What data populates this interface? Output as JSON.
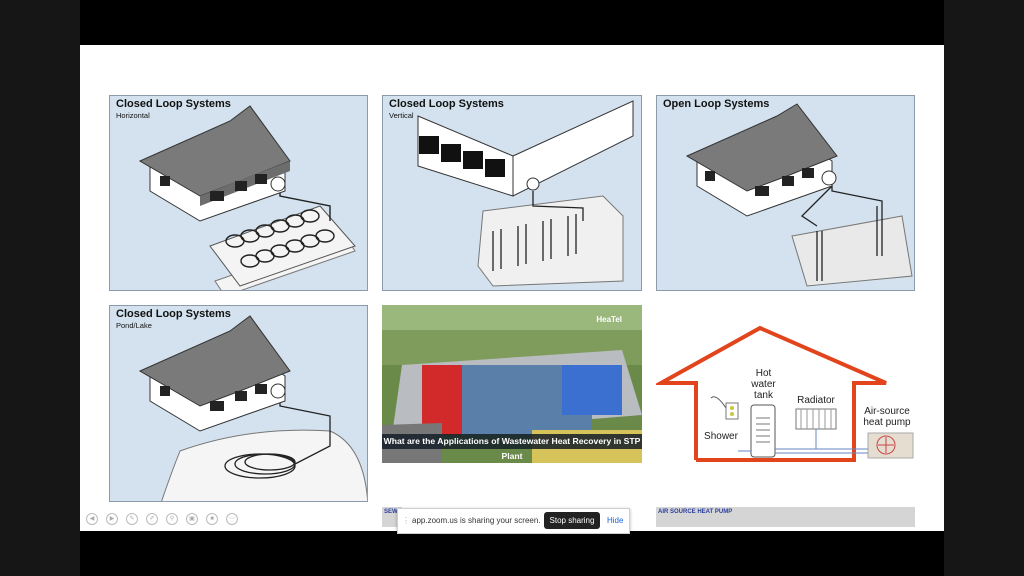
{
  "panels": {
    "closed_horizontal": {
      "title": "Closed Loop Systems",
      "subtitle": "Horizontal"
    },
    "closed_vertical": {
      "title": "Closed Loop Systems",
      "subtitle": "Vertical"
    },
    "open_loop": {
      "title": "Open Loop Systems"
    },
    "closed_pond": {
      "title": "Closed Loop Systems",
      "subtitle": "Pond/Lake"
    }
  },
  "photo": {
    "caption": "What are the Applications of Wastewater Heat Recovery in STP Plant",
    "logo": "HeaTel"
  },
  "ashp_diagram": {
    "hot_water_tank_line1": "Hot",
    "hot_water_tank_line2": "water",
    "hot_water_tank_line3": "tank",
    "radiator": "Radiator",
    "shower": "Shower",
    "air_source_line1": "Air-source",
    "air_source_line2": "heat pump",
    "house_color": "#e2451c"
  },
  "strips": {
    "left_label": "SEW",
    "right_label": "AIR SOURCE HEAT PUMP"
  },
  "share_bar": {
    "message": "app.zoom.us is sharing your screen.",
    "stop_label": "Stop sharing",
    "hide_label": "Hide"
  },
  "toolbar_icons": [
    "back-icon",
    "forward-icon",
    "pen-icon",
    "edit-icon",
    "zoom-icon",
    "slides-icon",
    "camera-icon",
    "more-icon"
  ]
}
